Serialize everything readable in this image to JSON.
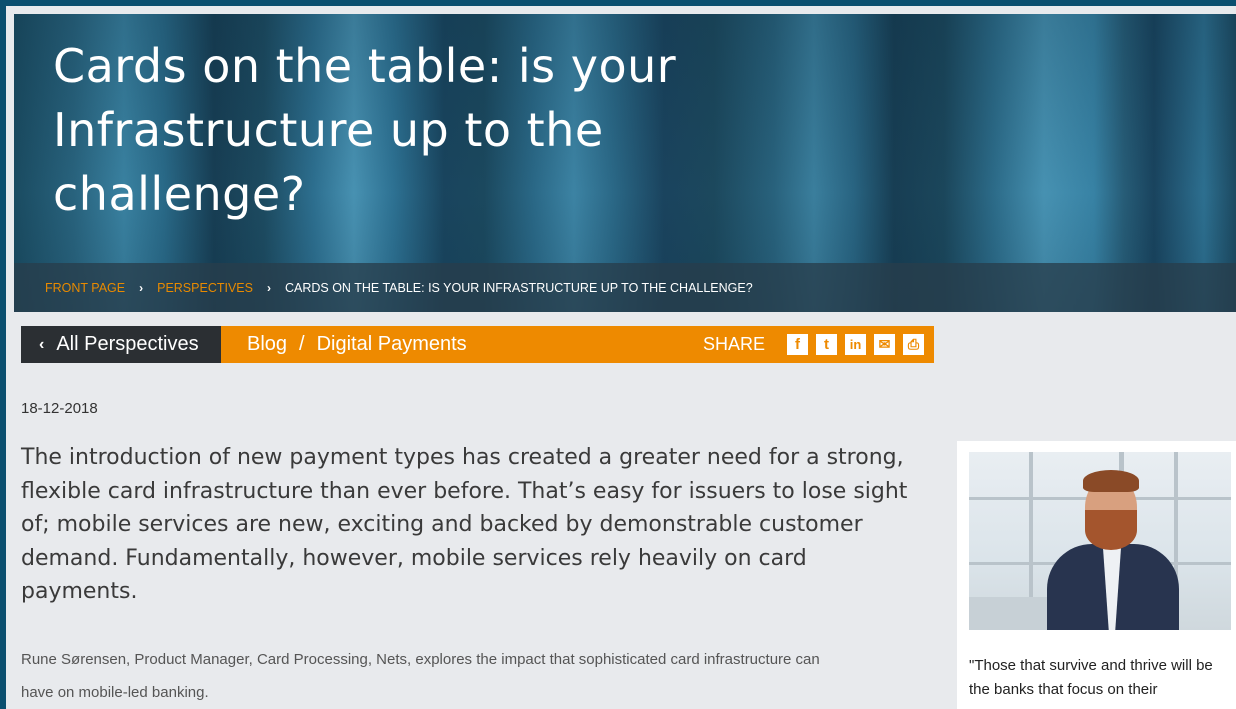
{
  "hero": {
    "title": "Cards on the table: is your Infrastructure up to the challenge?"
  },
  "breadcrumb": {
    "items": [
      "FRONT PAGE",
      "PERSPECTIVES"
    ],
    "current": "CARDS ON THE TABLE: IS YOUR INFRASTRUCTURE UP TO THE CHALLENGE?",
    "link_color": "#e88a00"
  },
  "toolbar": {
    "back_label": "All Perspectives",
    "category": "Blog",
    "separator": "/",
    "subcategory": "Digital Payments",
    "share_label": "SHARE",
    "accent_color": "#ee8a00",
    "share_icons": [
      "facebook-icon",
      "twitter-icon",
      "linkedin-icon",
      "mail-icon",
      "print-icon"
    ],
    "share_glyphs": [
      "f",
      "t",
      "in",
      "✉",
      "⎙"
    ]
  },
  "article": {
    "date": "18-12-2018",
    "lead": "The introduction of new payment types has created a greater need for a strong, flexible card infrastructure than ever before. That’s easy for issuers to lose sight of; mobile services are new, exciting and backed by demonstrable customer demand. Fundamentally, however, mobile services rely heavily on card payments.",
    "intro": "Rune Sørensen, Product Manager, Card Processing, Nets, explores the impact that sophisticated card infrastructure can have on mobile-led banking."
  },
  "sidebar": {
    "quote": "\"Those that survive and thrive will be the banks that focus on their"
  }
}
